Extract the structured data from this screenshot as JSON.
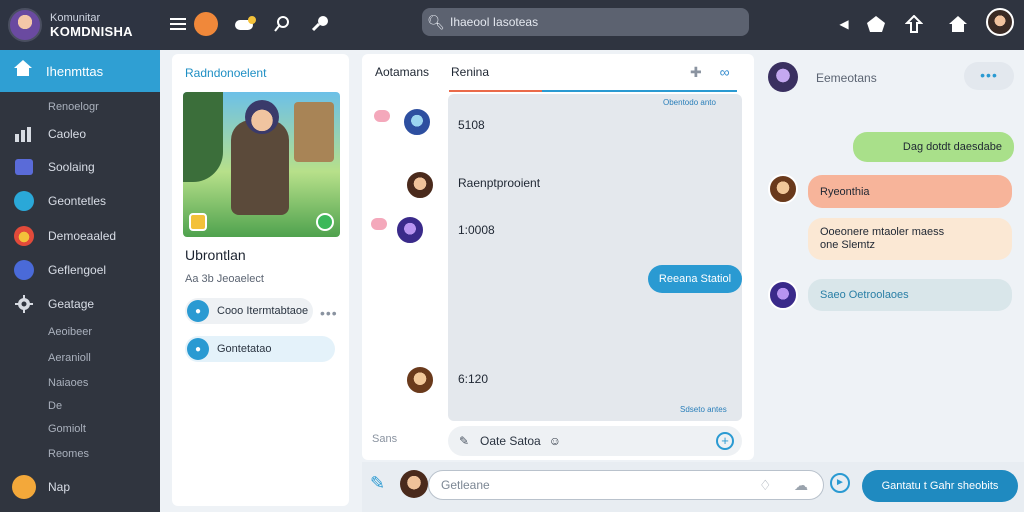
{
  "brand": {
    "line1": "Komunitar",
    "line2": "KOMDNISHA"
  },
  "search": {
    "placeholder": "Ihaeool Iasoteas"
  },
  "sidebar": {
    "active": "Ihenmttas",
    "items": [
      {
        "label": "Renoelogr",
        "sub": true
      },
      {
        "label": "Caoleo",
        "icon": "chart-icon",
        "color": "#d7dbe2"
      },
      {
        "label": "Soolaing",
        "icon": "window-icon",
        "color": "#5a6bd8"
      },
      {
        "label": "Geontetles",
        "icon": "globe-icon",
        "color": "#2aa8d8"
      },
      {
        "label": "Demoeaaled",
        "icon": "character-icon",
        "color": "#e24a3a"
      },
      {
        "label": "Geflengoel",
        "icon": "user-icon",
        "color": "#4a6ad8"
      },
      {
        "label": "Geatage",
        "icon": "gear-icon",
        "color": "#d7dbe2"
      },
      {
        "label": "Aeoibeer",
        "sub": true
      },
      {
        "label": "Aeranioll",
        "sub": true
      },
      {
        "label": "Naiaoes",
        "sub": true
      },
      {
        "label": "De",
        "sub": true
      },
      {
        "label": "Gomiolt",
        "sub": true
      },
      {
        "label": "Reomes",
        "sub": true
      },
      {
        "label": "Nap",
        "icon": "smiley-icon",
        "color": "#f3a83a"
      }
    ]
  },
  "card": {
    "title": "Radndonoelent",
    "name": "Ubrontlan",
    "subtitle": "Aa 3b Jeoaelect",
    "pill1": "Cooo Itermtabtaoe",
    "pill2": "Gontetatao",
    "more": "•••"
  },
  "center": {
    "tab1": "Aotamans",
    "tab2": "Renina",
    "feed_tag_top": "Obentodo anto",
    "feed_tag_bottom": "Sdseto antes",
    "messages": [
      {
        "text": "5108"
      },
      {
        "text": "Raenptprooient"
      },
      {
        "text": "1:0008"
      },
      {
        "text": "6:120"
      }
    ],
    "chip": "Reeana Statiol",
    "composer": "Oate Satoa",
    "sans": "Sans"
  },
  "right": {
    "name": "Eemeotans",
    "more": "•••",
    "bubbles": {
      "green": "Dag dotdt daesdabe",
      "salmon": "Ryeonthia",
      "cream_line1": "Ooeonere mtaoler maess",
      "cream_line2": "one Slemtz",
      "grey": "Saeo Oetroolaoes"
    }
  },
  "bottom": {
    "placeholder": "Getleane",
    "send": "Gantatu t Gahr sheobits"
  },
  "colors": {
    "accent": "#2a9ad2",
    "sidebar_bg": "#30353f",
    "topbar_bg": "#2f3440",
    "tab_underline_a": "#ea6a4a",
    "send_button": "#1f8ac0"
  }
}
